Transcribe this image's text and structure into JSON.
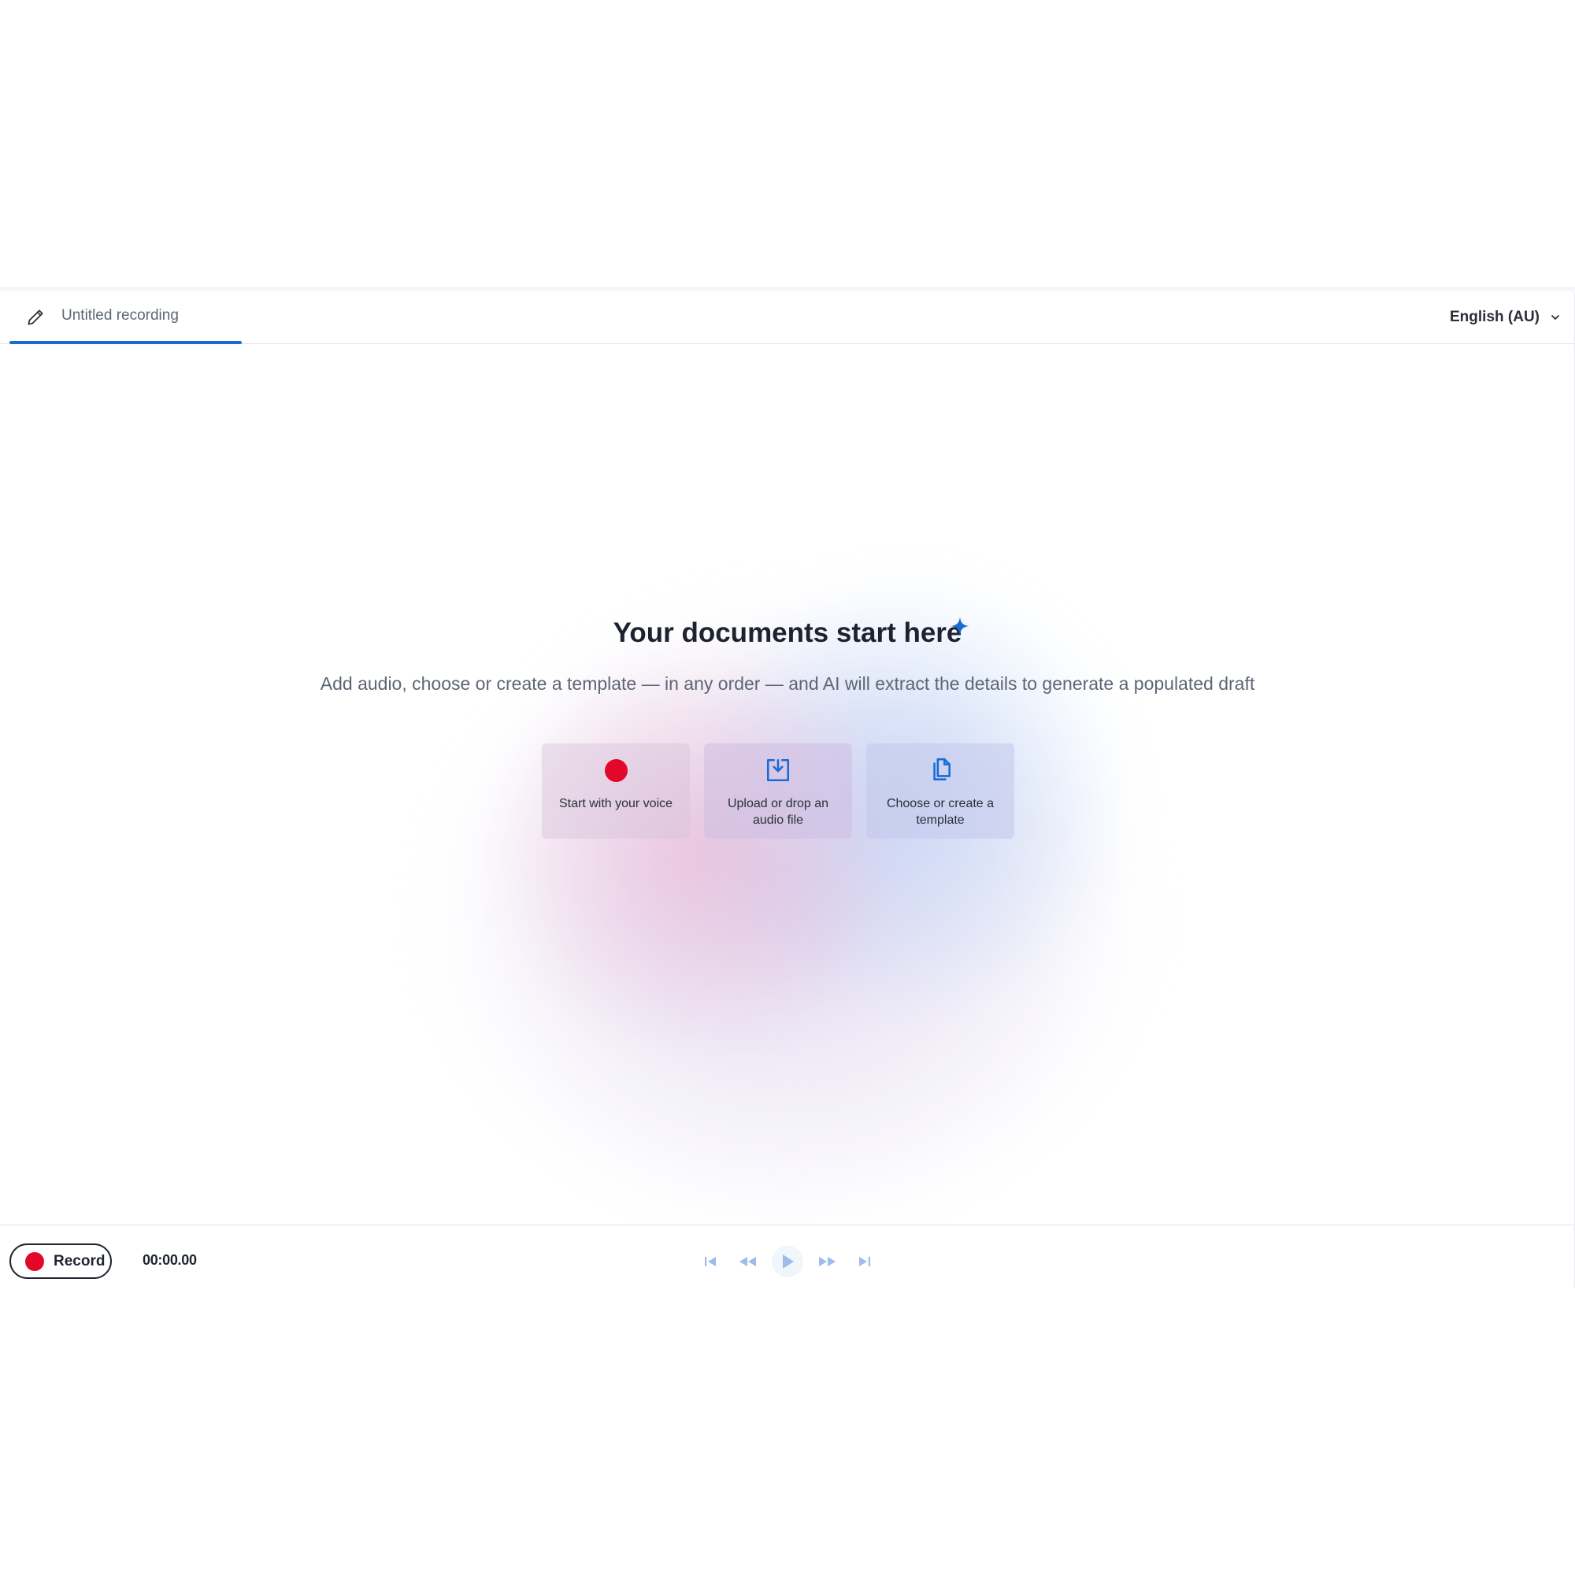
{
  "tab": {
    "title": "Untitled recording"
  },
  "language": {
    "selected": "English (AU)"
  },
  "hero": {
    "title": "Your documents start here",
    "subtitle": "Add audio, choose or create a template — in any order — and AI will extract the details to generate a populated draft"
  },
  "cards": [
    {
      "label": "Start with your voice",
      "icon": "record-dot-icon"
    },
    {
      "label": "Upload or drop an audio file",
      "icon": "upload-file-icon"
    },
    {
      "label": "Choose or create a template",
      "icon": "copy-documents-icon"
    }
  ],
  "footer": {
    "record_label": "Record",
    "timer": "00:00.00"
  },
  "colors": {
    "accent": "#1a6ad6",
    "record_red": "#e3072b",
    "transport_disabled": "#9cbde6"
  }
}
